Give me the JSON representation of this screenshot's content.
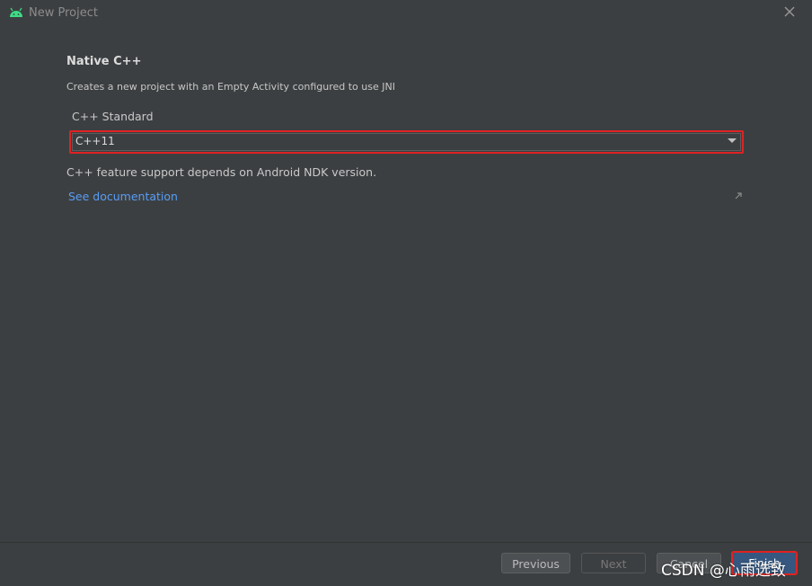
{
  "window": {
    "title": "New Project"
  },
  "main": {
    "heading": "Native C++",
    "description": "Creates a new project with an Empty Activity configured to use JNI",
    "cpp_standard": {
      "label": "C++ Standard",
      "selected_value": "C++11"
    },
    "hint": "C++ feature support depends on Android NDK version.",
    "doc_link": "See documentation"
  },
  "footer": {
    "previous_label": "Previous",
    "next_label": "Next",
    "cancel_label": "Cancel",
    "finish_label": "Finish"
  },
  "watermark": {
    "text": "CSDN @心雨选致"
  },
  "colors": {
    "background": "#3c3f41",
    "link": "#589df6",
    "highlight_border": "#e02222",
    "android_green": "#3ddc84",
    "primary_button": "#365880"
  },
  "icons": {
    "app_icon": "android-icon",
    "close_icon": "close-icon",
    "external_link_icon": "external-link-icon",
    "dropdown_icon": "chevron-down-icon"
  }
}
